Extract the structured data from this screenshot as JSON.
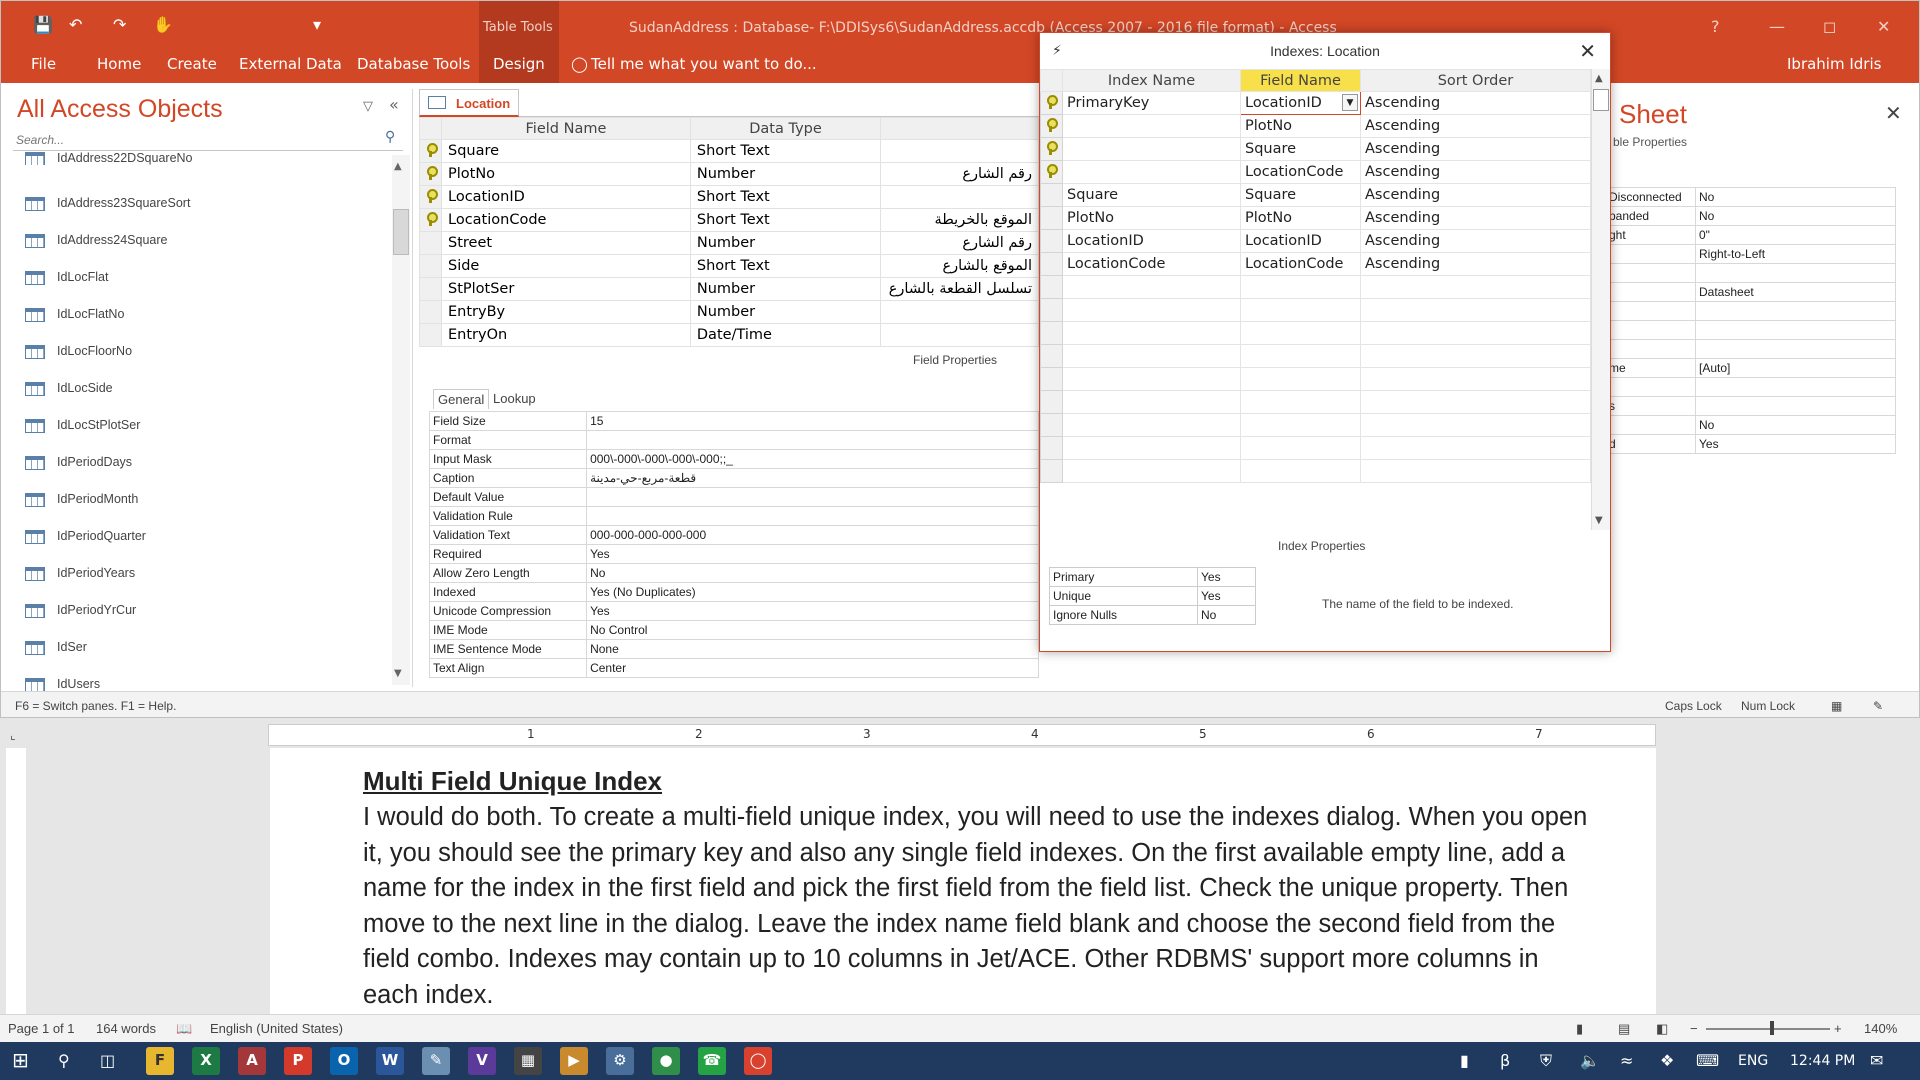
{
  "access": {
    "window_title": "SudanAddress : Database- F:\\DDISys6\\SudanAddress.accdb (Access 2007 - 2016 file format) - Access",
    "tab_tools_label": "Table Tools",
    "tabs": [
      "File",
      "Home",
      "Create",
      "External Data",
      "Database Tools",
      "Design"
    ],
    "tell_me": "Tell me what you want to do...",
    "user": "Ibrahim Idris",
    "nav": {
      "header": "All Access Objects",
      "search_placeholder": "Search...",
      "items": [
        "IdAddress22DSquareNo",
        "IdAddress23SquareSort",
        "IdAddress24Square",
        "IdLocFlat",
        "IdLocFlatNo",
        "IdLocFloorNo",
        "IdLocSide",
        "IdLocStPlotSer",
        "IdPeriodDays",
        "IdPeriodMonth",
        "IdPeriodQuarter",
        "IdPeriodYears",
        "IdPeriodYrCur",
        "IdSer",
        "IdUsers"
      ]
    },
    "table_tab": "Location",
    "fields": {
      "headers": [
        "Field Name",
        "Data Type"
      ],
      "rows": [
        {
          "name": "Square",
          "type": "Short Text",
          "desc": ""
        },
        {
          "name": "PlotNo",
          "type": "Number",
          "desc": "رقم الشارع"
        },
        {
          "name": "LocationID",
          "type": "Short Text",
          "desc": ""
        },
        {
          "name": "LocationCode",
          "type": "Short Text",
          "desc": "الموقع بالخريطة"
        },
        {
          "name": "Street",
          "type": "Number",
          "desc": "رقم الشارع"
        },
        {
          "name": "Side",
          "type": "Short Text",
          "desc": "الموقع بالشارع"
        },
        {
          "name": "StPlotSer",
          "type": "Number",
          "desc": "تسلسل القطعة بالشارع"
        },
        {
          "name": "EntryBy",
          "type": "Number",
          "desc": ""
        },
        {
          "name": "EntryOn",
          "type": "Date/Time",
          "desc": ""
        }
      ]
    },
    "field_properties": {
      "title": "Field Properties",
      "tab_general": "General",
      "tab_lookup": "Lookup",
      "rows": [
        {
          "n": "Field Size",
          "v": "15"
        },
        {
          "n": "Format",
          "v": ""
        },
        {
          "n": "Input Mask",
          "v": "000\\-000\\-000\\-000\\-000;;_"
        },
        {
          "n": "Caption",
          "v": "قطعة-مربع-حي-مدينة"
        },
        {
          "n": "Default Value",
          "v": ""
        },
        {
          "n": "Validation Rule",
          "v": ""
        },
        {
          "n": "Validation Text",
          "v": "000-000-000-000-000"
        },
        {
          "n": "Required",
          "v": "Yes"
        },
        {
          "n": "Allow Zero Length",
          "v": "No"
        },
        {
          "n": "Indexed",
          "v": "Yes (No Duplicates)"
        },
        {
          "n": "Unicode Compression",
          "v": "Yes"
        },
        {
          "n": "IME Mode",
          "v": "No Control"
        },
        {
          "n": "IME Sentence Mode",
          "v": "None"
        },
        {
          "n": "Text Align",
          "v": "Center"
        }
      ]
    },
    "property_sheet": {
      "title": "Sheet",
      "subtitle": "ble Properties",
      "rows": [
        {
          "n": "Disconnected",
          "v": "No"
        },
        {
          "n": "panded",
          "v": "No"
        },
        {
          "n": "ght",
          "v": "0\""
        },
        {
          "n": "",
          "v": "Right-to-Left"
        },
        {
          "n": "",
          "v": ""
        },
        {
          "n": "",
          "v": "Datasheet"
        },
        {
          "n": "",
          "v": ""
        },
        {
          "n": "",
          "v": ""
        },
        {
          "n": "",
          "v": ""
        },
        {
          "n": "me",
          "v": "[Auto]"
        },
        {
          "n": "",
          "v": ""
        },
        {
          "n": "s",
          "v": ""
        },
        {
          "n": "",
          "v": "No"
        },
        {
          "n": "d",
          "v": "Yes"
        }
      ]
    },
    "status_left": "F6 = Switch panes.  F1 = Help.",
    "status_caps": "Caps Lock",
    "status_num": "Num Lock"
  },
  "indexes": {
    "title": "Indexes: Location",
    "headers": [
      "Index Name",
      "Field Name",
      "Sort Order"
    ],
    "rows": [
      {
        "index": "PrimaryKey",
        "field": "LocationID",
        "sort": "Ascending",
        "key": true
      },
      {
        "index": "",
        "field": "PlotNo",
        "sort": "Ascending",
        "key": true
      },
      {
        "index": "",
        "field": "Square",
        "sort": "Ascending",
        "key": true
      },
      {
        "index": "",
        "field": "LocationCode",
        "sort": "Ascending",
        "key": true
      },
      {
        "index": "Square",
        "field": "Square",
        "sort": "Ascending",
        "key": false
      },
      {
        "index": "PlotNo",
        "field": "PlotNo",
        "sort": "Ascending",
        "key": false
      },
      {
        "index": "LocationID",
        "field": "LocationID",
        "sort": "Ascending",
        "key": false
      },
      {
        "index": "LocationCode",
        "field": "LocationCode",
        "sort": "Ascending",
        "key": false
      }
    ],
    "properties_title": "Index Properties",
    "properties": [
      {
        "n": "Primary",
        "v": "Yes"
      },
      {
        "n": "Unique",
        "v": "Yes"
      },
      {
        "n": "Ignore Nulls",
        "v": "No"
      }
    ],
    "help": "The name of the field to be indexed."
  },
  "word": {
    "ruler_marks": [
      "1",
      "2",
      "3",
      "4",
      "5",
      "6",
      "7"
    ],
    "heading": "Multi Field Unique Index",
    "body": "I would do both. To create a multi-field unique index, you will need to use the indexes dialog. When you open it, you should see the primary key and also any single field indexes. On the first available empty line, add a name for the index in the first field and pick the first field from the field list. Check the unique property. Then move to the next line in the dialog. Leave the index name field blank and choose the second field from the field combo. Indexes may contain up to 10 columns in Jet/ACE. Other RDBMS' support more columns in each index.",
    "status_page": "Page 1 of 1",
    "status_words": "164 words",
    "status_lang": "English (United States)",
    "zoom": "140%"
  },
  "taskbar": {
    "lang": "ENG",
    "time": "12:44 PM"
  },
  "colors": {
    "accent": "#d24726",
    "field_header_highlight": "#f7e04a"
  }
}
